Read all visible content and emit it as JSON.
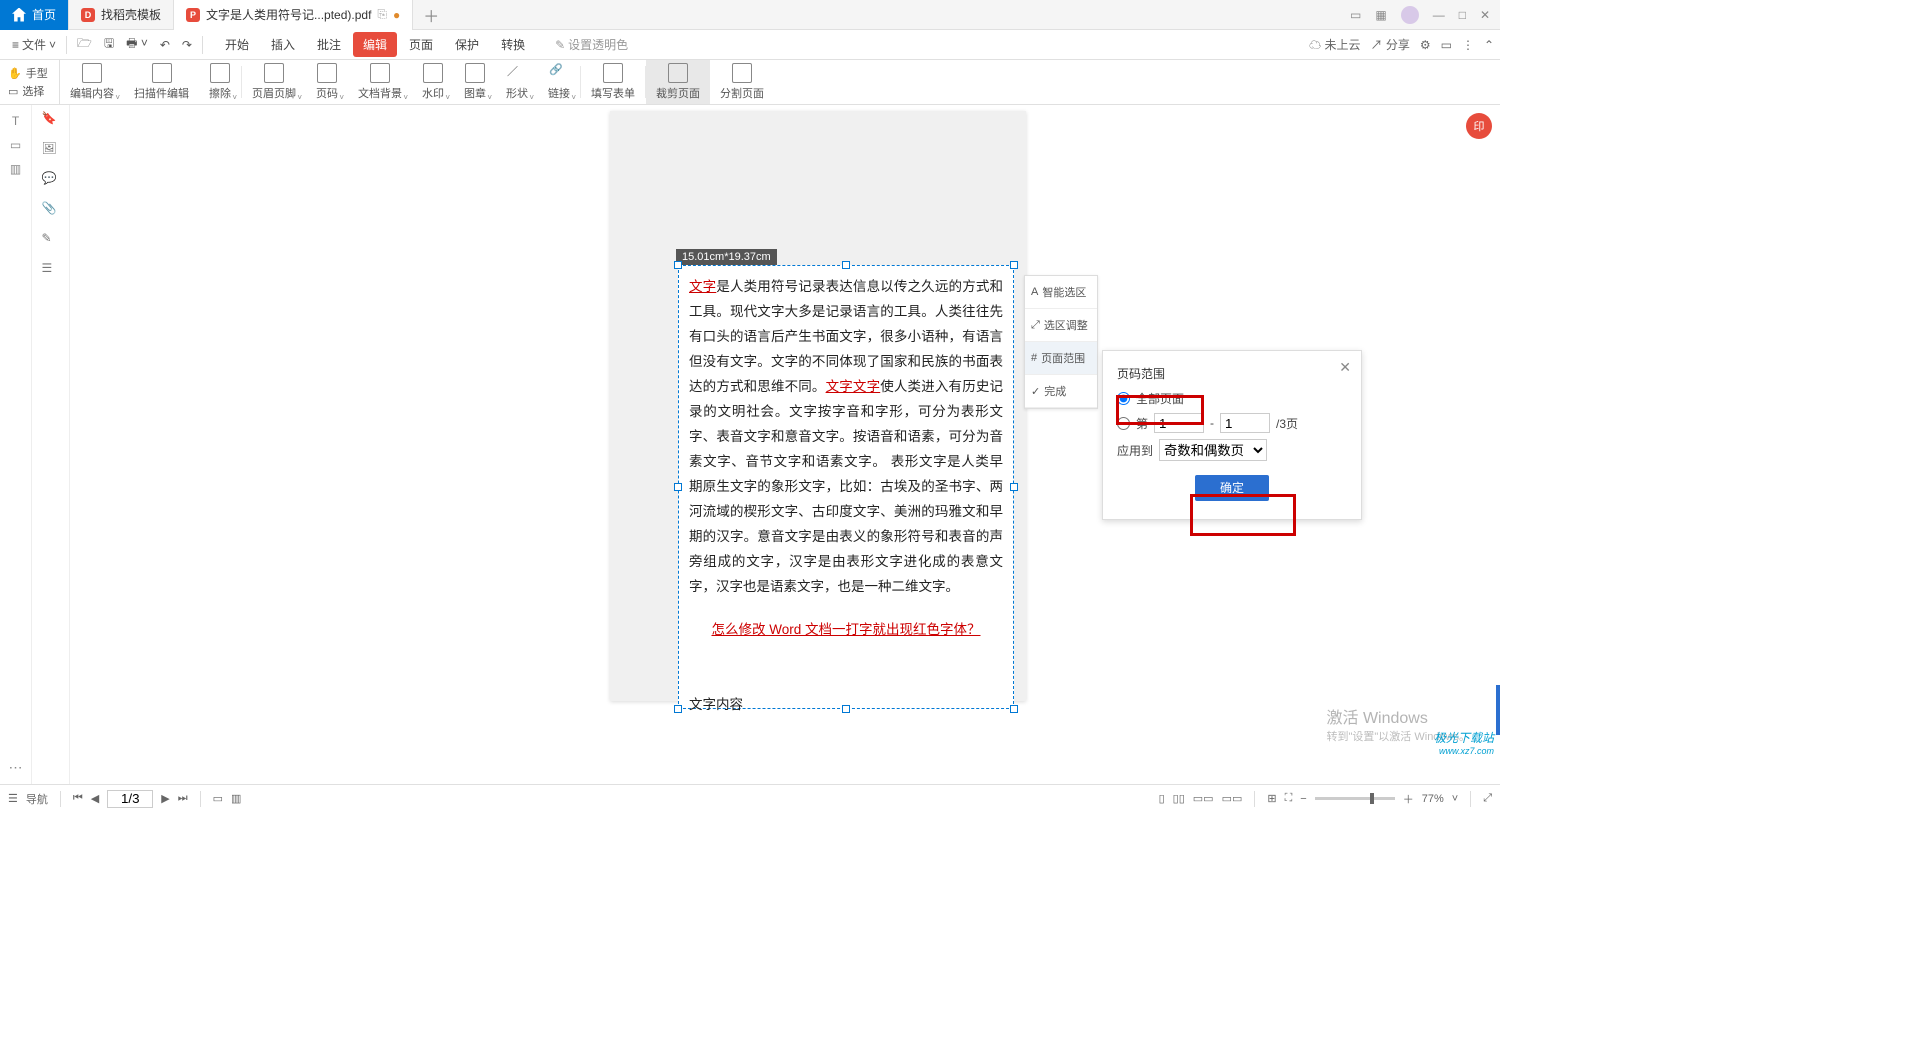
{
  "tabs": {
    "home": "首页",
    "second": "找稻壳模板",
    "active": "文字是人类用符号记...pted).pdf"
  },
  "menu": {
    "file": "文件",
    "groups": [
      "开始",
      "插入",
      "批注",
      "编辑",
      "页面",
      "保护",
      "转换"
    ],
    "bgcolor": "设置透明色",
    "cloud": "未上云",
    "share": "分享"
  },
  "mode": {
    "hand": "手型",
    "select": "选择"
  },
  "ribbon": {
    "items": [
      "编辑内容",
      "扫描件编辑",
      "擦除",
      "页眉页脚",
      "页码",
      "文档背景",
      "水印",
      "图章",
      "形状",
      "链接",
      "填写表单",
      "裁剪页面",
      "分割页面"
    ],
    "activeIndex": 11
  },
  "dims": "15.01cm*19.37cm",
  "doc": {
    "w1": "文字",
    "p1a": "是人类用符号记录表达信息以传之久远的方式和工具。现代文字大多是记录语言的工具。人类往往先有口头的语言后产生书面文字，很多小语种，有语言但没有文字。文字的不同体现了国家和民族的书面表达的方式和思维不同。",
    "w2": "文字文字",
    "p1b": "使人类进入有历史记录的文明社会。文字按字音和字形，可分为表形文字、表音文字和意音文字。按语音和语素，可分为音素文字、音节文字和语素文字。  表形文字是人类早期原生文字的象形文字，比如：古埃及的圣书字、两河流域的楔形文字、古印度文字、美洲的玛雅文和早期的汉字。意音文字是由表义的象形符号和表音的声旁组成的文字，汉字是由表形文字进化成的表意文字，汉字也是语素文字，也是一种二维文字。",
    "link": "怎么修改 Word 文档一打字就出现红色字体？",
    "footer": "文字内容"
  },
  "minipanel": [
    "智能选区",
    "选区调整",
    "页面范围",
    "完成"
  ],
  "minipanelActive": 2,
  "rpanel": {
    "title": "页码范围",
    "opt_all": "全部页面",
    "opt_range_prefix": "第",
    "range_from": "1",
    "range_to": "1",
    "range_suffix": "/3页",
    "apply_label": "应用到",
    "apply_value": "奇数和偶数页",
    "confirm": "确定"
  },
  "activate": {
    "t": "激活 Windows",
    "s": "转到\"设置\"以激活 Windows。"
  },
  "site": {
    "name": "极光下载站",
    "url": "www.xz7.com"
  },
  "status": {
    "nav": "导航",
    "page": "1/3",
    "zoom": "77%"
  }
}
